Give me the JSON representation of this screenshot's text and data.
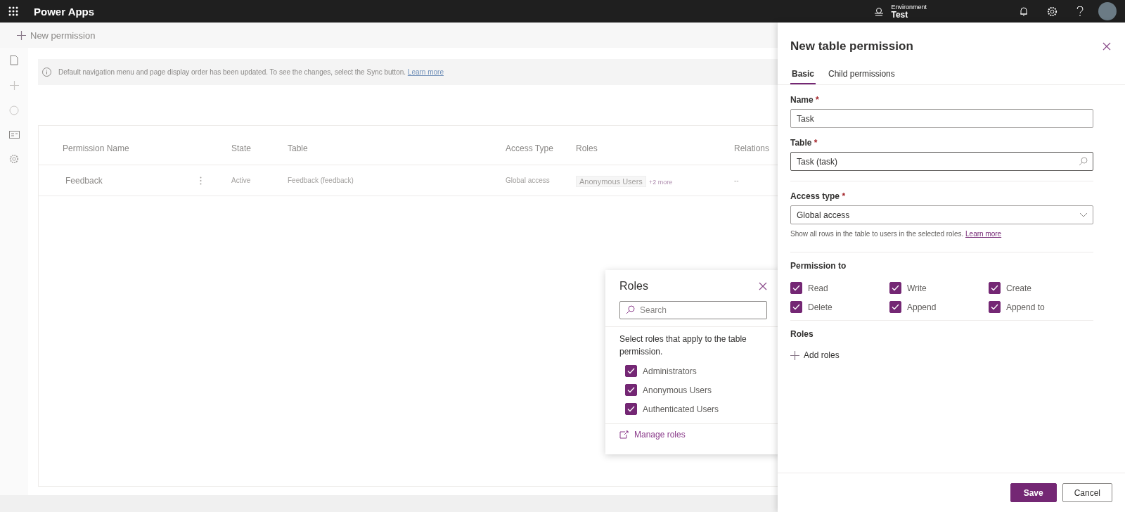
{
  "top_bar": {
    "app_name": "Power Apps",
    "environment_label": "Environment",
    "environment_name": "Test"
  },
  "toolbar": {
    "new_button": "New permission"
  },
  "notice": {
    "text": "Default navigation menu and page display order has been updated. To see the changes, select the Sync button.",
    "link": "Learn more"
  },
  "table": {
    "columns": [
      "Permission Name",
      "State",
      "Table",
      "Access Type",
      "Roles",
      "Relations"
    ],
    "rows": [
      {
        "name": "Feedback",
        "state": "Active",
        "table": "Feedback (feedback)",
        "access_type": "Global access",
        "role": "Anonymous Users",
        "more_roles": "+2 more",
        "relations": "--"
      }
    ]
  },
  "roles_popup": {
    "title": "Roles",
    "search_placeholder": "Search",
    "description": "Select roles that apply to the table permission.",
    "roles": [
      {
        "label": "Administrators",
        "checked": true
      },
      {
        "label": "Anonymous Users",
        "checked": true
      },
      {
        "label": "Authenticated Users",
        "checked": true
      }
    ],
    "manage_link": "Manage roles"
  },
  "panel": {
    "title": "New table permission",
    "tabs": [
      {
        "label": "Basic",
        "selected": true
      },
      {
        "label": "Child permissions",
        "selected": false
      }
    ],
    "name_field": {
      "label": "Name",
      "required_mark": "*",
      "value": "Task"
    },
    "table_field": {
      "label": "Table",
      "required_mark": "*",
      "value": "Task (task)"
    },
    "access_field": {
      "label": "Access type",
      "required_mark": "*",
      "value": "Global access",
      "help": "Show all rows in the table to users in the selected roles.",
      "help_link": "Learn more"
    },
    "permissions": {
      "heading": "Permission to",
      "items": [
        {
          "label": "Read",
          "checked": true
        },
        {
          "label": "Write",
          "checked": true
        },
        {
          "label": "Create",
          "checked": true
        },
        {
          "label": "Delete",
          "checked": true
        },
        {
          "label": "Append",
          "checked": true
        },
        {
          "label": "Append to",
          "checked": true
        }
      ]
    },
    "roles": {
      "heading": "Roles",
      "add_button": "Add roles"
    },
    "buttons": [
      {
        "label": "Save",
        "kind": "primary"
      },
      {
        "label": "Cancel",
        "kind": "secondary"
      }
    ]
  }
}
